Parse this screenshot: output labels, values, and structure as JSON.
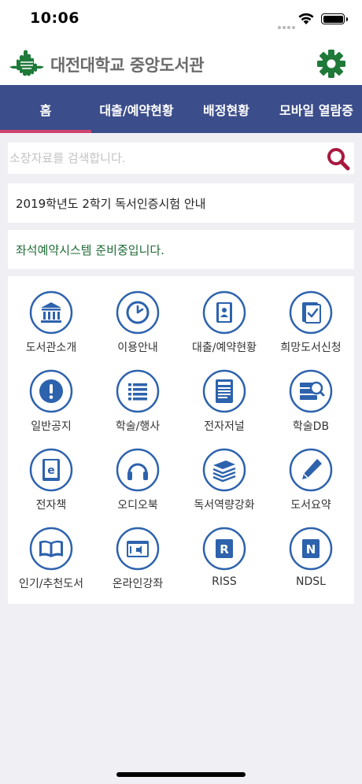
{
  "status_bar": {
    "time": "10:06"
  },
  "header": {
    "title": "대전대학교 중앙도서관",
    "brand_color": "#1f7a3a"
  },
  "nav": {
    "tabs": [
      {
        "label": "홈",
        "active": true
      },
      {
        "label": "대출/예약현황",
        "active": false
      },
      {
        "label": "배정현황",
        "active": false
      },
      {
        "label": "모바일 열람증",
        "active": false
      }
    ],
    "background_color": "#3b4d8a",
    "active_indicator_color": "#d0436e"
  },
  "search": {
    "placeholder": "소장자료를 검색합니다.",
    "value": "",
    "icon": "search-icon"
  },
  "notices": [
    {
      "text": "2019학년도 2학기 독서인증시험 안내"
    },
    {
      "text": "좌석예약시스템 준비중입니다."
    }
  ],
  "menu": {
    "items": [
      {
        "label": "도서관소개",
        "icon": "library-building-icon"
      },
      {
        "label": "이용안내",
        "icon": "clock-icon"
      },
      {
        "label": "대출/예약현황",
        "icon": "book-user-icon"
      },
      {
        "label": "희망도서신청",
        "icon": "book-check-icon"
      },
      {
        "label": "일반공지",
        "icon": "exclamation-icon"
      },
      {
        "label": "학술/행사",
        "icon": "list-icon"
      },
      {
        "label": "전자저널",
        "icon": "journal-icon"
      },
      {
        "label": "학술DB",
        "icon": "database-search-icon"
      },
      {
        "label": "전자책",
        "icon": "ebook-icon"
      },
      {
        "label": "오디오북",
        "icon": "headphones-icon"
      },
      {
        "label": "독서역량강화",
        "icon": "book-stack-icon"
      },
      {
        "label": "도서요약",
        "icon": "pen-icon"
      },
      {
        "label": "인기/추천도서",
        "icon": "open-book-icon"
      },
      {
        "label": "온라인강좌",
        "icon": "video-player-icon"
      },
      {
        "label": "RISS",
        "icon": "riss-icon",
        "badge": "R"
      },
      {
        "label": "NDSL",
        "icon": "ndsl-icon",
        "badge": "N"
      }
    ],
    "icon_color": "#2d62ad"
  }
}
